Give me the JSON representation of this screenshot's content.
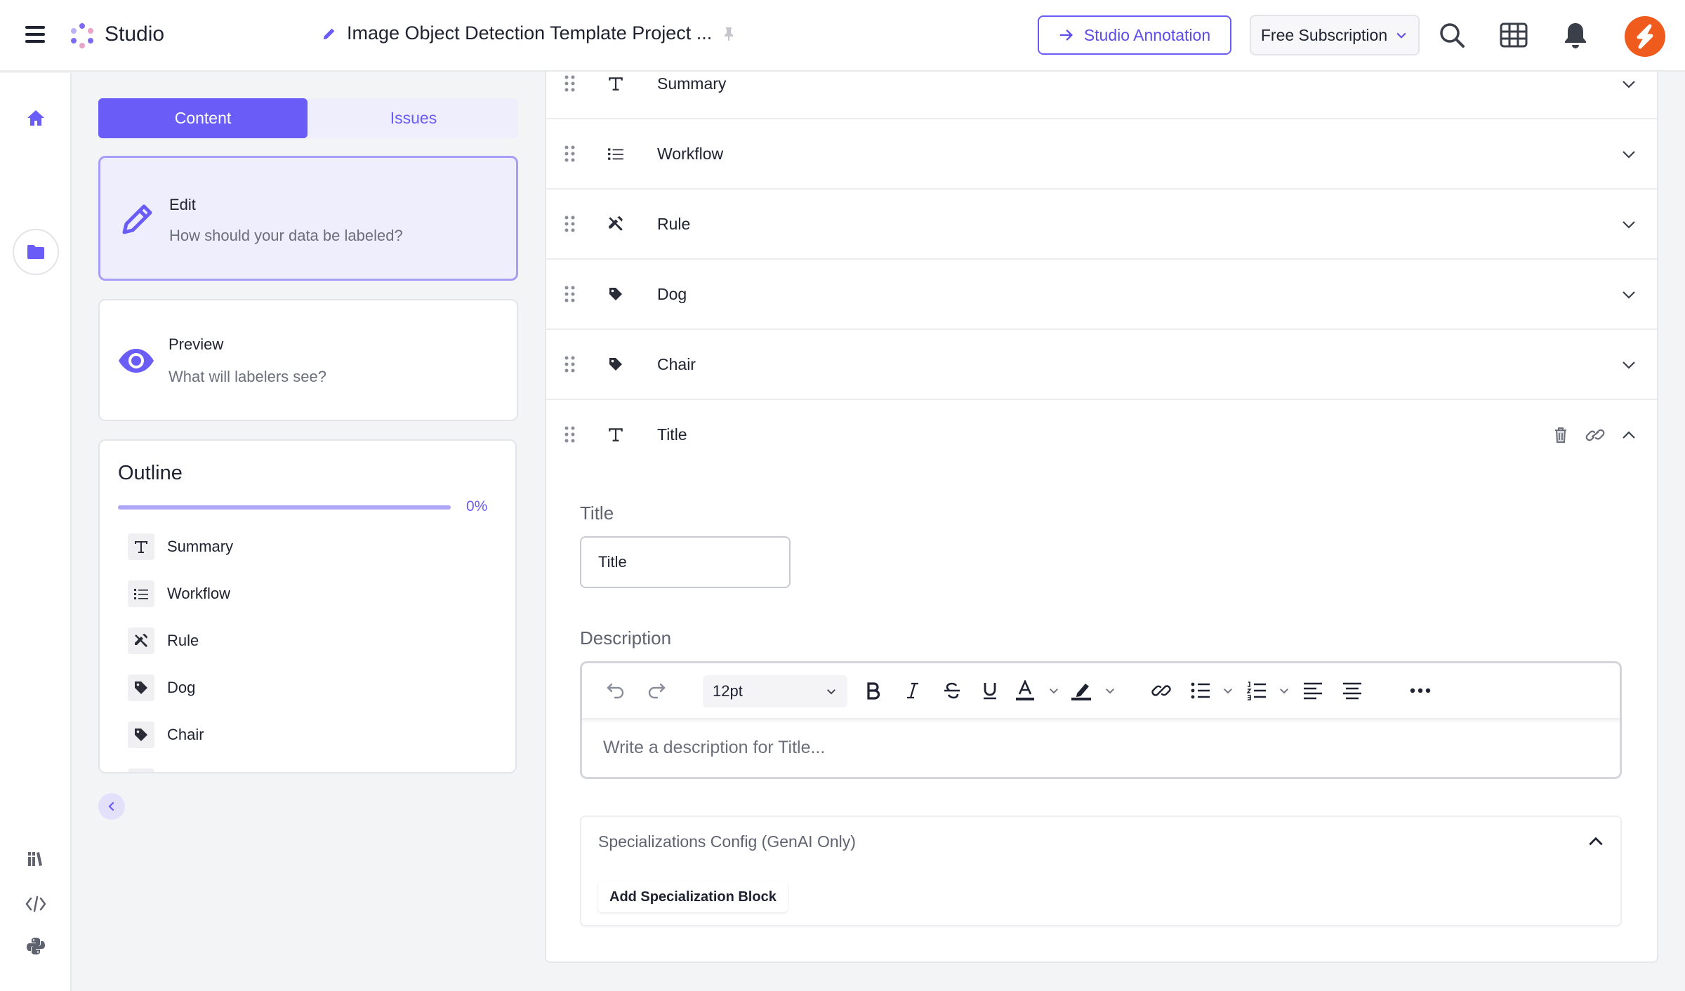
{
  "header": {
    "brand": "Studio",
    "project_title": "Image Object Detection Template Project ...",
    "annotation_button": "Studio Annotation",
    "subscription": "Free Subscription"
  },
  "left_panel": {
    "tabs": [
      {
        "label": "Content",
        "active": true
      },
      {
        "label": "Issues",
        "active": false
      }
    ],
    "edit_card": {
      "title": "Edit",
      "subtitle": "How should your data be labeled?"
    },
    "preview_card": {
      "title": "Preview",
      "subtitle": "What will labelers see?"
    },
    "outline": {
      "title": "Outline",
      "progress_label": "0%",
      "progress": 0,
      "items": [
        {
          "label": "Summary",
          "icon": "text-icon"
        },
        {
          "label": "Workflow",
          "icon": "list-icon"
        },
        {
          "label": "Rule",
          "icon": "rule-icon"
        },
        {
          "label": "Dog",
          "icon": "tag-icon"
        },
        {
          "label": "Chair",
          "icon": "tag-icon"
        }
      ]
    }
  },
  "main": {
    "rows": [
      {
        "label": "Summary",
        "icon": "text-icon"
      },
      {
        "label": "Workflow",
        "icon": "list-icon"
      },
      {
        "label": "Rule",
        "icon": "rule-icon"
      },
      {
        "label": "Dog",
        "icon": "tag-icon"
      },
      {
        "label": "Chair",
        "icon": "tag-icon"
      },
      {
        "label": "Title",
        "icon": "text-icon",
        "expanded": true
      }
    ],
    "title_section_label": "Title",
    "title_value": "Title",
    "description_label": "Description",
    "editor": {
      "font_size": "12pt",
      "placeholder": "Write a description for Title..."
    },
    "specializations": {
      "title": "Specializations Config (GenAI Only)",
      "button": "Add Specialization Block"
    }
  },
  "colors": {
    "accent": "#6a5cf6",
    "avatar": "#ef5b1d"
  }
}
